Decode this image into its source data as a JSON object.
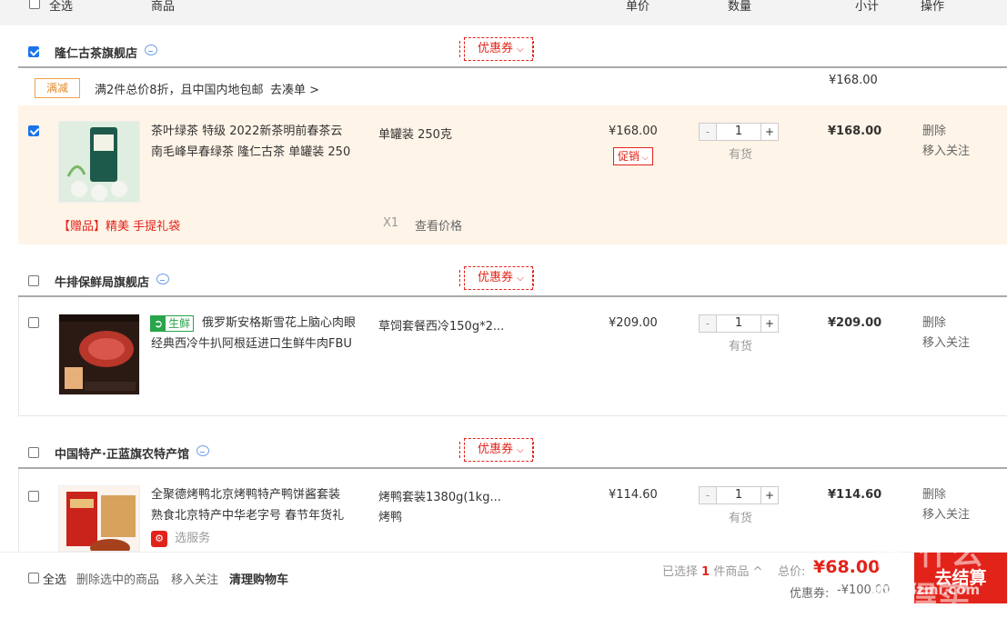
{
  "header": {
    "select_all": "全选",
    "goods": "商品",
    "unit_price": "单价",
    "quantity": "数量",
    "subtotal": "小计",
    "actions": "操作"
  },
  "shops": [
    {
      "name": "隆仁古茶旗舰店",
      "coupon": "优惠券",
      "checked": true,
      "promo": {
        "tag": "满减",
        "text": "满2件总价8折，且中国内地包邮",
        "link": "去凑单 >",
        "total": "¥168.00"
      },
      "item": {
        "title_line1": "茶叶绿茶 特级 2022新茶明前春茶云",
        "title_line2": "南毛峰早春绿茶 隆仁古茶 单罐装 250",
        "spec": "单罐装 250克",
        "price": "¥168.00",
        "promo_label": "促销",
        "qty": "1",
        "stock": "有货",
        "subtotal": "¥168.00",
        "delete": "删除",
        "follow": "移入关注",
        "gift": "【赠品】精美 手提礼袋",
        "gift_qty": "X1",
        "gift_link": "查看价格"
      }
    },
    {
      "name": "牛排保鲜局旗舰店",
      "coupon": "优惠券",
      "checked": false,
      "item": {
        "badge": "生鲜",
        "title_line1": "俄罗斯安格斯雪花上脑心肉眼",
        "title_line2": "经典西冷牛扒阿根廷进口生鲜牛肉FBU",
        "spec": "草饲套餐西冷150g*2...",
        "price": "¥209.00",
        "qty": "1",
        "stock": "有货",
        "subtotal": "¥209.00",
        "delete": "删除",
        "follow": "移入关注"
      }
    },
    {
      "name": "中国特产·正蓝旗农特产馆",
      "coupon": "优惠券",
      "checked": false,
      "item": {
        "title_line1": "全聚德烤鸭北京烤鸭特产鸭饼酱套装",
        "title_line2": "熟食北京特产中华老字号 春节年货礼",
        "service": "选服务",
        "spec_line1": "烤鸭套装1380g(1kg...",
        "spec_line2": "烤鸭",
        "price": "¥114.60",
        "qty": "1",
        "stock": "有货",
        "subtotal": "¥114.60",
        "delete": "删除",
        "follow": "移入关注"
      }
    }
  ],
  "footer": {
    "select_all": "全选",
    "delete_selected": "删除选中的商品",
    "move_follow": "移入关注",
    "clear_cart": "清理购物车",
    "selected_prefix": "已选择",
    "selected_count": "1",
    "selected_suffix": "件商品",
    "total_label": "总价:",
    "total_value": "¥68.00",
    "coupon_label": "优惠券:",
    "coupon_value": "-¥100.00",
    "checkout": "去结算",
    "watermark": "值 什么值得买",
    "watermark_url": "zhizhizmi.com"
  },
  "colors": {
    "accent_red": "#e2231a",
    "selected_row_bg": "#fff4e8",
    "checkout_bg": "#e2231a"
  }
}
